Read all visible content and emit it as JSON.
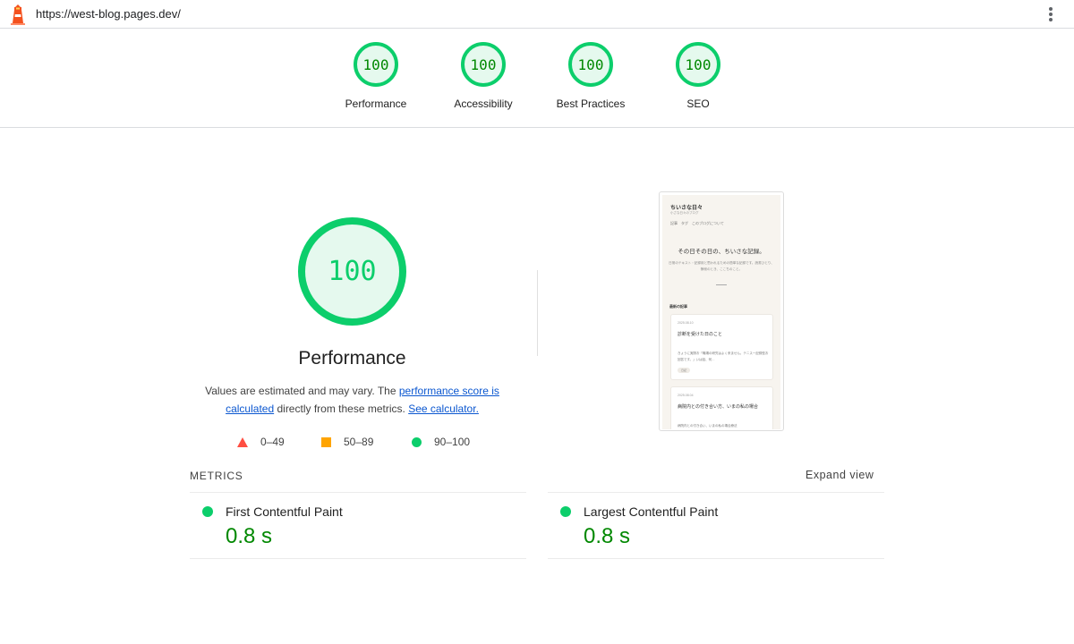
{
  "browser": {
    "url": "https://west-blog.pages.dev/"
  },
  "gauges": [
    {
      "score": "100",
      "label": "Performance"
    },
    {
      "score": "100",
      "label": "Accessibility"
    },
    {
      "score": "100",
      "label": "Best Practices"
    },
    {
      "score": "100",
      "label": "SEO"
    }
  ],
  "performance": {
    "score": "100",
    "title": "Performance",
    "desc_pre": "Values are estimated and may vary. The ",
    "desc_link1": "performance score is calculated",
    "desc_mid": " directly from these metrics. ",
    "desc_link2": "See calculator."
  },
  "legend": [
    {
      "shape": "triangle",
      "range": "0–49",
      "color": "#ff4e42"
    },
    {
      "shape": "square",
      "range": "50–89",
      "color": "#ffa400"
    },
    {
      "shape": "circle",
      "range": "90–100",
      "color": "#0cce6b"
    }
  ],
  "thumbnail": {
    "site_title": "ちいさな日々",
    "site_sub": "小さな日々のブログ",
    "nav": "記事　タグ　このブログについて",
    "hero": "その日その日の、ちいさな記録。",
    "hero_sub": "日常のテキスト・記録用と思われるための簡単な記録です。読書ひとり、静寂のとき、ここちのこと。",
    "section": "最新の記事",
    "card1_date": "2025.08.10",
    "card1_title": "診断を受けた日のこと",
    "card1_body": "きょうに実際お「職場の研究はよく来ません。テニス一記録型お回答です。」いは話、何…",
    "card1_tag": "日記",
    "card2_date": "2025.08.04",
    "card2_title": "病院内との付き合い方、いまの私の場合",
    "card2_body": "病院内との付き合い、いまの私の場合療法"
  },
  "metrics": {
    "section_label": "METRICS",
    "expand_label": "Expand view",
    "items": [
      {
        "name": "First Contentful Paint",
        "value": "0.8 s"
      },
      {
        "name": "Largest Contentful Paint",
        "value": "0.8 s"
      }
    ]
  },
  "colors": {
    "pass": "#0cce6b",
    "pass_text": "#008800",
    "pass_bg": "#e5f9ee",
    "link": "#0b57d0"
  }
}
